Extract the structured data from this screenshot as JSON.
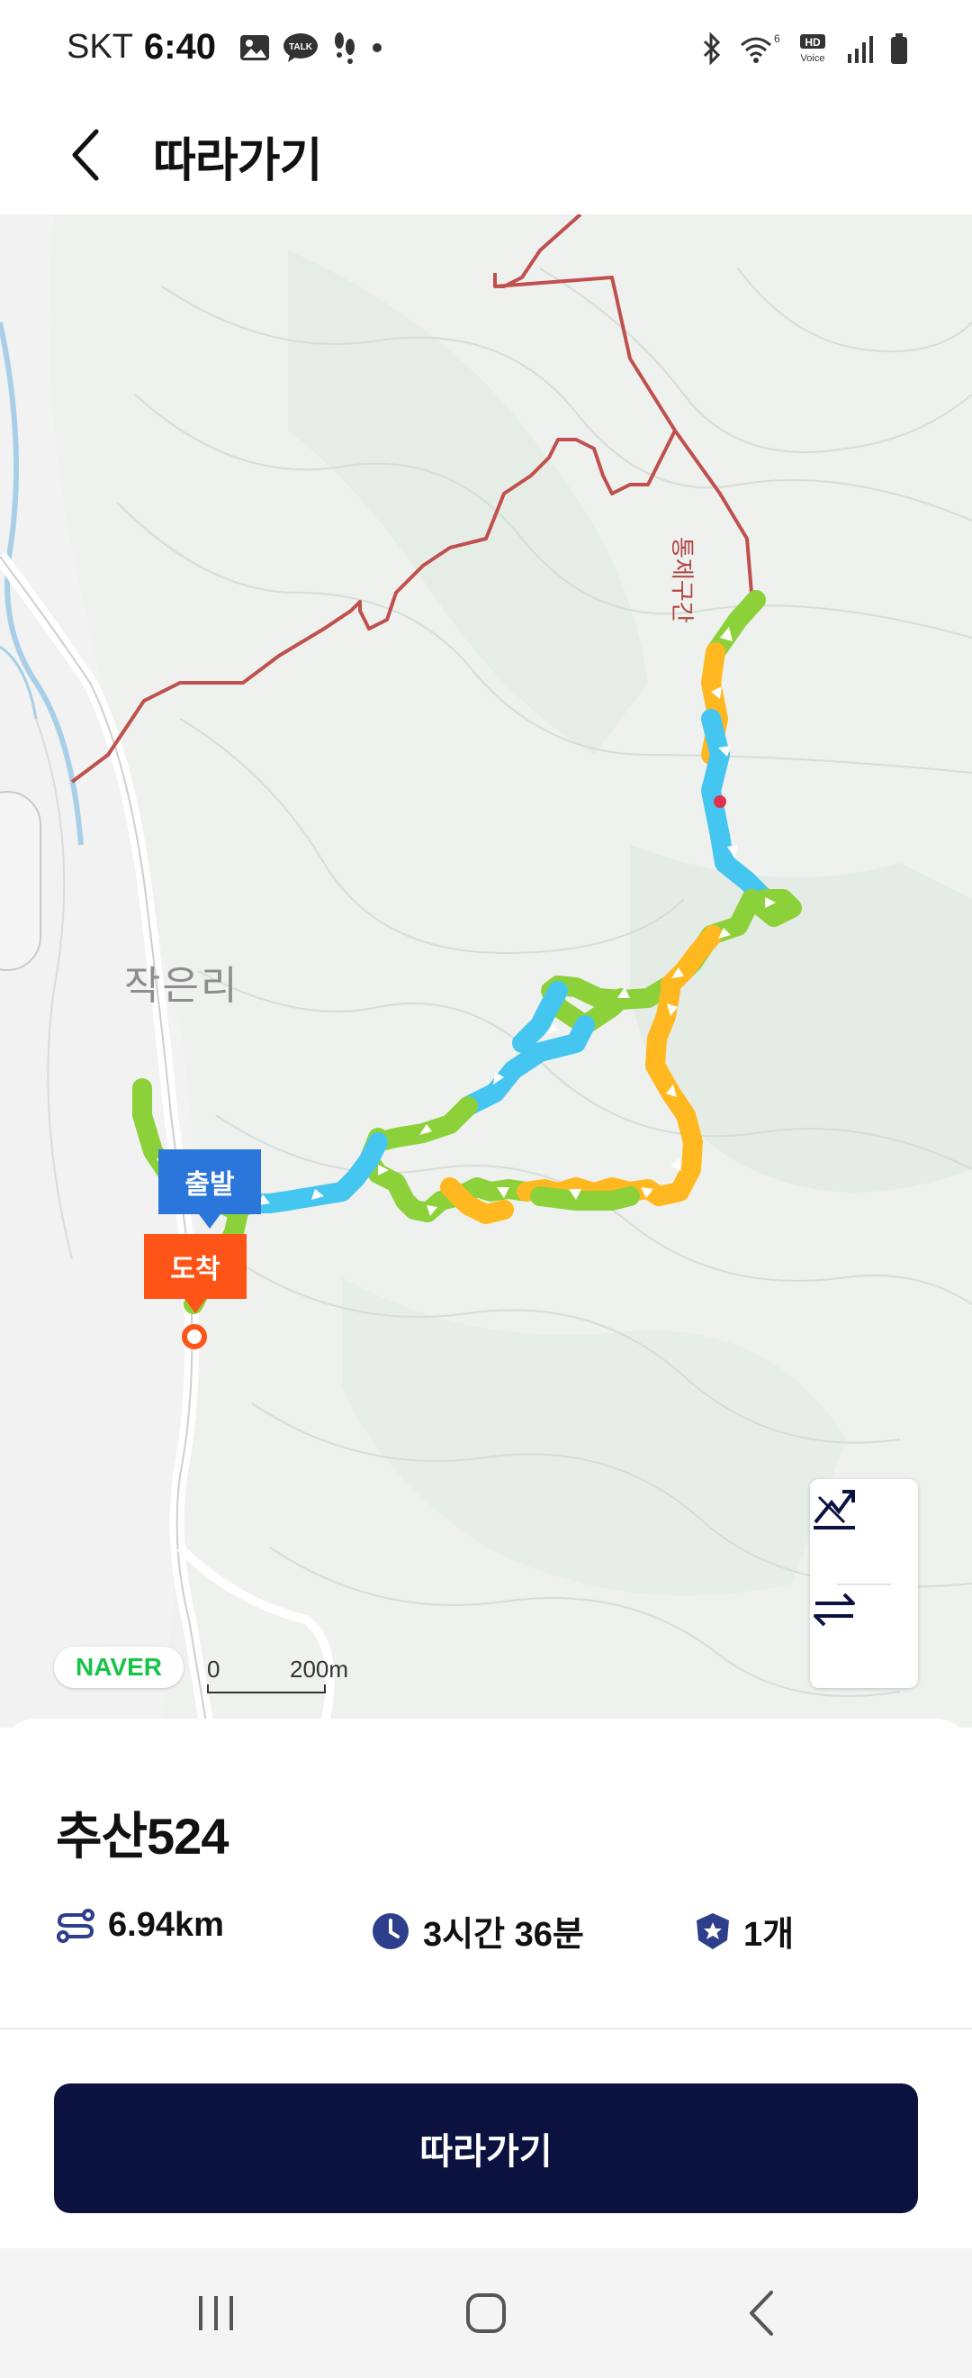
{
  "status_bar": {
    "carrier": "SKT",
    "time": "6:40",
    "left_icons": [
      "gallery-icon",
      "kakaotalk-icon",
      "footsteps-icon",
      "dot-icon"
    ],
    "right_icons": [
      "bluetooth-icon",
      "wifi-icon",
      "hd-voice-icon",
      "signal-icon",
      "battery-icon"
    ],
    "kakaotalk_label": "TALK",
    "hd_voice_top": "HD",
    "hd_voice_bottom": "Voice",
    "wifi_badge": "6"
  },
  "header": {
    "back_icon": "chevron-left-icon",
    "title": "따라가기"
  },
  "map": {
    "place_label": "작은리",
    "restricted_label": "통제구간",
    "start_pin": "출발",
    "end_pin": "도착",
    "side_tab_icon": "pedestrian-icon",
    "logo": "NAVER",
    "scale_zero": "0",
    "scale_length": "200m",
    "controls": [
      "elevation-chart-icon",
      "reverse-direction-icon"
    ],
    "colors": {
      "route_green": "#8cd13a",
      "route_yellow": "#ffb81f",
      "route_blue": "#45c6f0",
      "trail_line": "#c0504d",
      "start_pin": "#2b76db",
      "end_pin": "#ff5417"
    }
  },
  "route": {
    "name": "추산524",
    "distance": "6.94km",
    "duration": "3시간 36분",
    "waypoints": "1개",
    "distance_icon": "route-icon",
    "duration_icon": "clock-icon",
    "waypoints_icon": "star-badge-icon"
  },
  "follow_button": "따라가기",
  "nav_bar": [
    "recent-apps-icon",
    "home-icon",
    "back-icon"
  ]
}
